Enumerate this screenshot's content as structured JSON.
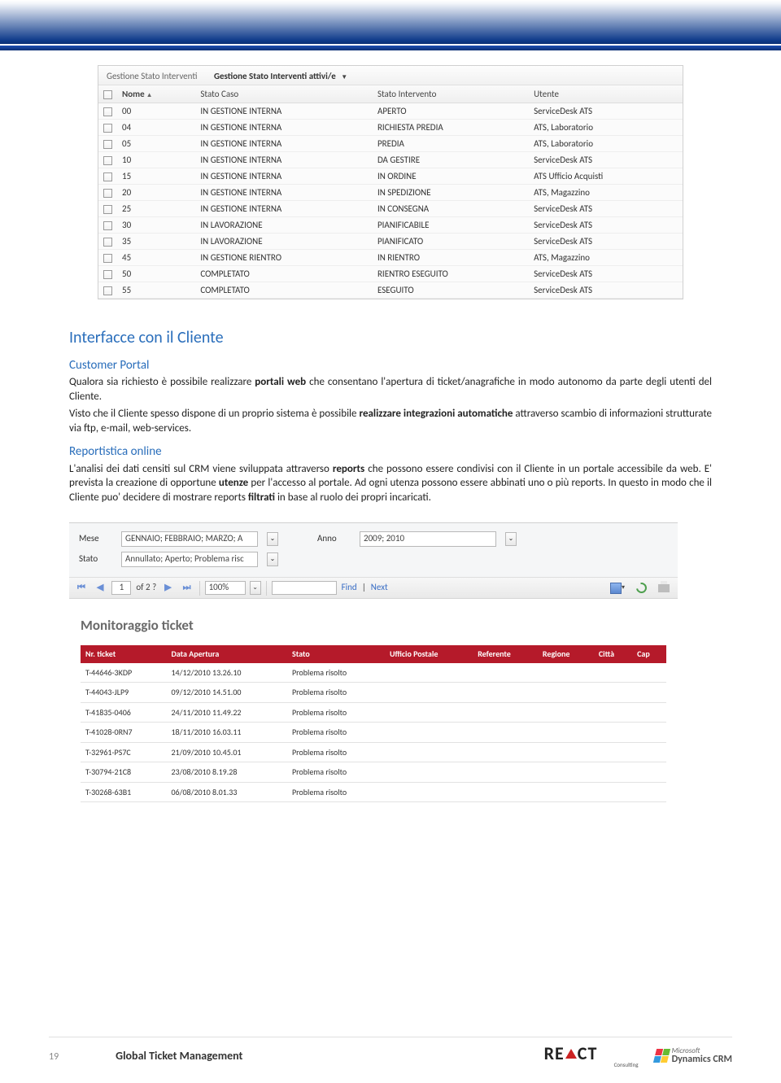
{
  "crm1": {
    "view_label": "Gestione Stato Interventi",
    "view_name": "Gestione Stato Interventi attivi/e",
    "cols": [
      "Nome",
      "Stato Caso",
      "Stato Intervento",
      "Utente"
    ],
    "rows": [
      {
        "nome": "00",
        "stato": "IN GESTIONE INTERNA",
        "interv": "APERTO",
        "utente": "ServiceDesk ATS"
      },
      {
        "nome": "04",
        "stato": "IN GESTIONE INTERNA",
        "interv": "RICHIESTA PREDIA",
        "utente": "ATS, Laboratorio"
      },
      {
        "nome": "05",
        "stato": "IN GESTIONE INTERNA",
        "interv": "PREDIA",
        "utente": "ATS, Laboratorio"
      },
      {
        "nome": "10",
        "stato": "IN GESTIONE INTERNA",
        "interv": "DA GESTIRE",
        "utente": "ServiceDesk ATS"
      },
      {
        "nome": "15",
        "stato": "IN GESTIONE INTERNA",
        "interv": "IN ORDINE",
        "utente": "ATS Ufficio Acquisti"
      },
      {
        "nome": "20",
        "stato": "IN GESTIONE INTERNA",
        "interv": "IN SPEDIZIONE",
        "utente": "ATS, Magazzino"
      },
      {
        "nome": "25",
        "stato": "IN GESTIONE INTERNA",
        "interv": "IN CONSEGNA",
        "utente": "ServiceDesk ATS"
      },
      {
        "nome": "30",
        "stato": "IN LAVORAZIONE",
        "interv": "PIANIFICABILE",
        "utente": "ServiceDesk ATS"
      },
      {
        "nome": "35",
        "stato": "IN LAVORAZIONE",
        "interv": "PIANIFICATO",
        "utente": "ServiceDesk ATS"
      },
      {
        "nome": "45",
        "stato": "IN GESTIONE RIENTRO",
        "interv": "IN RIENTRO",
        "utente": "ATS, Magazzino"
      },
      {
        "nome": "50",
        "stato": "COMPLETATO",
        "interv": "RIENTRO ESEGUITO",
        "utente": "ServiceDesk ATS"
      },
      {
        "nome": "55",
        "stato": "COMPLETATO",
        "interv": "ESEGUITO",
        "utente": "ServiceDesk ATS"
      }
    ]
  },
  "section": {
    "h2": "Interfacce con il Cliente",
    "h3a": "Customer Portal",
    "p1_a": "Qualora sia richiesto è possibile realizzare ",
    "p1_b": "portali web",
    "p1_c": " che consentano l'apertura di ticket/anagrafiche in modo autonomo da parte degli utenti del Cliente.",
    "p2_a": "Visto che il Cliente spesso dispone di un proprio sistema è possibile ",
    "p2_b": "realizzare integrazioni automatiche",
    "p2_c": " attraverso scambio di informazioni strutturate via ftp, e-mail, web-services.",
    "h3b": "Reportistica online",
    "p3_a": "L'analisi dei dati censiti sul CRM viene sviluppata attraverso ",
    "p3_b": "reports",
    "p3_c": " che possono essere condivisi con il Cliente in un portale accessibile da web. E' prevista la creazione di opportune ",
    "p3_d": "utenze",
    "p3_e": " per l'accesso al portale. Ad ogni utenza possono essere abbinati uno o più reports. In questo in modo che il Cliente puo' decidere di mostrare reports ",
    "p3_f": "filtrati",
    "p3_g": " in base al ruolo dei propri incaricati."
  },
  "report": {
    "params": {
      "mese_lbl": "Mese",
      "mese_val": "GENNAIO; FEBBRAIO; MARZO; A",
      "anno_lbl": "Anno",
      "anno_val": "2009; 2010",
      "stato_lbl": "Stato",
      "stato_val": "Annullato; Aperto; Problema risc"
    },
    "toolbar": {
      "page": "1",
      "of": "of 2 ?",
      "zoom": "100%",
      "find": "Find",
      "next": "Next"
    },
    "title": "Monitoraggio ticket",
    "cols": [
      "Nr. ticket",
      "Data Apertura",
      "Stato",
      "Ufficio Postale",
      "Referente",
      "Regione",
      "Città",
      "Cap"
    ],
    "rows": [
      {
        "n": "T-44646-3KDP",
        "d": "14/12/2010 13.26.10",
        "s": "Problema risolto"
      },
      {
        "n": "T-44043-JLP9",
        "d": "09/12/2010 14.51.00",
        "s": "Problema risolto"
      },
      {
        "n": "T-41835-0406",
        "d": "24/11/2010 11.49.22",
        "s": "Problema risolto"
      },
      {
        "n": "T-41028-0RN7",
        "d": "18/11/2010 16.03.11",
        "s": "Problema risolto"
      },
      {
        "n": "T-32961-PS7C",
        "d": "21/09/2010 10.45.01",
        "s": "Problema risolto"
      },
      {
        "n": "T-30794-21C8",
        "d": "23/08/2010 8.19.28",
        "s": "Problema risolto"
      },
      {
        "n": "T-30268-63B1",
        "d": "06/08/2010 8.01.33",
        "s": "Problema risolto"
      }
    ]
  },
  "footer": {
    "page": "19",
    "doc_title": "Global Ticket Management",
    "react": "RE  CT",
    "react_sub": "Consulting",
    "ms1": "Microsoft",
    "ms2": "Dynamics CRM"
  }
}
